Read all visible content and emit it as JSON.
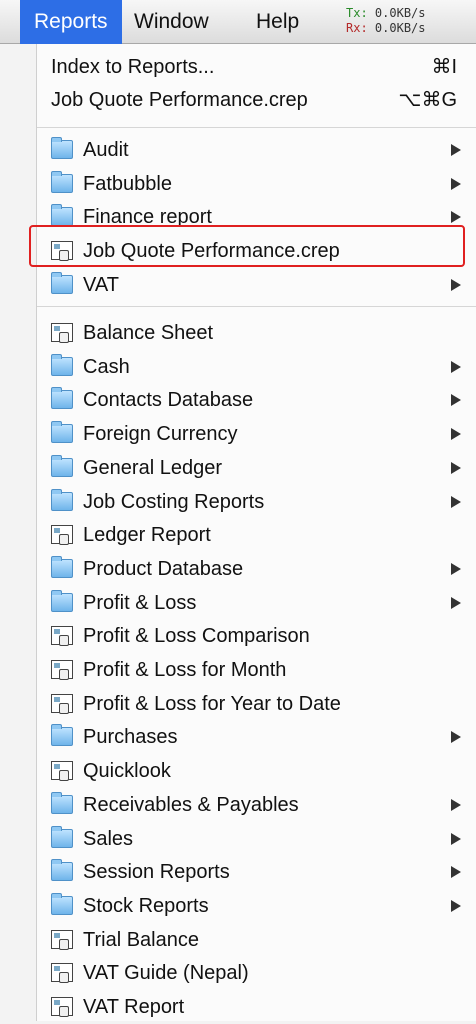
{
  "menubar": {
    "items": [
      {
        "label": "Reports",
        "active": true
      },
      {
        "label": "Window"
      },
      {
        "label": "Help"
      }
    ],
    "network": {
      "tx_label": "Tx:",
      "tx_value": "0.0KB/s",
      "rx_label": "Rx:",
      "rx_value": "0.0KB/s"
    }
  },
  "menu": {
    "top_items": [
      {
        "label": "Index to Reports...",
        "shortcut": "⌘I"
      },
      {
        "label": "Job Quote Performance.crep",
        "shortcut": "⌥⌘G"
      }
    ],
    "group1": [
      {
        "label": "Audit",
        "icon": "folder-icon",
        "submenu": true
      },
      {
        "label": "Fatbubble",
        "icon": "folder-icon",
        "submenu": true
      },
      {
        "label": "Finance report",
        "icon": "folder-icon",
        "submenu": true
      },
      {
        "label": "Job Quote Performance.crep",
        "icon": "report-icon",
        "submenu": false,
        "highlighted": true
      },
      {
        "label": "VAT",
        "icon": "folder-icon",
        "submenu": true
      }
    ],
    "group2": [
      {
        "label": "Balance Sheet",
        "icon": "report-icon",
        "submenu": false
      },
      {
        "label": "Cash",
        "icon": "folder-icon",
        "submenu": true
      },
      {
        "label": "Contacts Database",
        "icon": "folder-icon",
        "submenu": true
      },
      {
        "label": "Foreign Currency",
        "icon": "folder-icon",
        "submenu": true
      },
      {
        "label": "General Ledger",
        "icon": "folder-icon",
        "submenu": true
      },
      {
        "label": "Job Costing Reports",
        "icon": "folder-icon",
        "submenu": true
      },
      {
        "label": "Ledger Report",
        "icon": "report-icon",
        "submenu": false
      },
      {
        "label": "Product Database",
        "icon": "folder-icon",
        "submenu": true
      },
      {
        "label": "Profit & Loss",
        "icon": "folder-icon",
        "submenu": true
      },
      {
        "label": "Profit & Loss Comparison",
        "icon": "report-icon",
        "submenu": false
      },
      {
        "label": "Profit & Loss for Month",
        "icon": "report-icon",
        "submenu": false
      },
      {
        "label": "Profit & Loss for Year to Date",
        "icon": "report-icon",
        "submenu": false
      },
      {
        "label": "Purchases",
        "icon": "folder-icon",
        "submenu": true
      },
      {
        "label": "Quicklook",
        "icon": "report-icon",
        "submenu": false
      },
      {
        "label": "Receivables & Payables",
        "icon": "folder-icon",
        "submenu": true
      },
      {
        "label": "Sales",
        "icon": "folder-icon",
        "submenu": true
      },
      {
        "label": "Session Reports",
        "icon": "folder-icon",
        "submenu": true
      },
      {
        "label": "Stock Reports",
        "icon": "folder-icon",
        "submenu": true
      },
      {
        "label": "Trial Balance",
        "icon": "report-icon",
        "submenu": false
      },
      {
        "label": "VAT Guide (Nepal)",
        "icon": "report-icon",
        "submenu": false
      },
      {
        "label": "VAT Report",
        "icon": "report-icon",
        "submenu": false
      }
    ]
  },
  "colors": {
    "menubar_active": "#2d6ee6",
    "highlight_box": "#e02020"
  }
}
